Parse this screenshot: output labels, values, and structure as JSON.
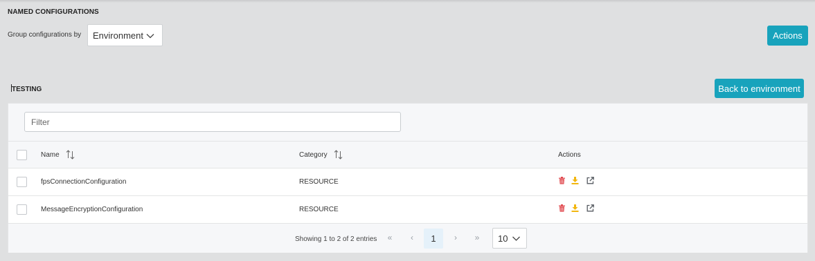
{
  "header": {
    "section_title": "NAMED CONFIGURATIONS",
    "group_label": "Group configurations by",
    "group_value": "Environment",
    "actions_label": "Actions"
  },
  "environment": {
    "title": "TESTING",
    "back_label": "Back to environment"
  },
  "filter": {
    "placeholder": "Filter"
  },
  "table": {
    "columns": [
      "Name",
      "Category",
      "Actions"
    ],
    "rows": [
      {
        "name": "fpsConnectionConfiguration",
        "category": "RESOURCE"
      },
      {
        "name": "MessageEncryptionConfiguration",
        "category": "RESOURCE"
      }
    ],
    "row_actions": [
      "trash-icon",
      "download-icon",
      "external-link-icon"
    ]
  },
  "pagination": {
    "info": "Showing 1 to 2 of 2 entries",
    "first": "«",
    "prev": "‹",
    "current_page": "1",
    "next": "›",
    "last": "»",
    "page_size": "10"
  },
  "colors": {
    "accent": "#18a3bc",
    "delete": "#e0474c",
    "download": "#f2b60f",
    "link": "#555a60"
  }
}
